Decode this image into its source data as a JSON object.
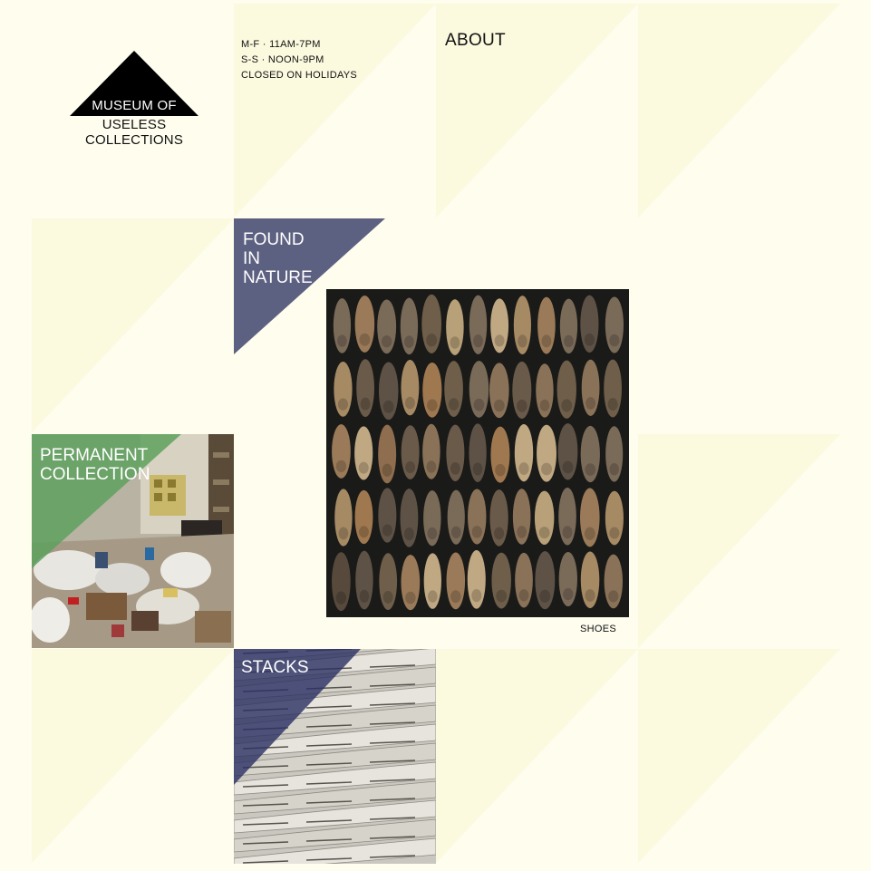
{
  "logo": {
    "line1": "MUSEUM OF",
    "line2": "USELESS COLLECTIONS"
  },
  "hours": {
    "weekdays": "M-F · 11AM-7PM",
    "weekends": "S-S · NOON-9PM",
    "holidays": "CLOSED ON HOLIDAYS"
  },
  "nav": {
    "about": "ABOUT"
  },
  "sections": {
    "found_in_nature": {
      "line1": "FOUND",
      "line2": "IN",
      "line3": "NATURE"
    },
    "permanent_collection": {
      "line1": "PERMANENT",
      "line2": "COLLECTION"
    },
    "stacks": {
      "label": "STACKS"
    }
  },
  "featured": {
    "caption": "SHOES"
  },
  "colors": {
    "background": "#fefdee",
    "tile": "#fbf9de",
    "nature_accent": "#5d6181",
    "permanent_accent": "#5aa05a",
    "stacks_accent": "#2b2f63"
  }
}
